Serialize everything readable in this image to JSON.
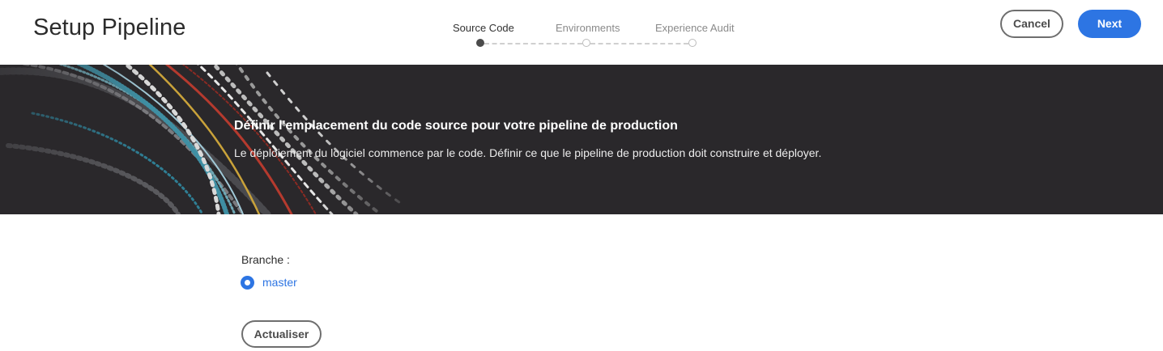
{
  "header": {
    "title": "Setup Pipeline",
    "cancel_label": "Cancel",
    "next_label": "Next"
  },
  "stepper": {
    "steps": [
      {
        "label": "Source Code",
        "state": "active"
      },
      {
        "label": "Environments",
        "state": "inactive"
      },
      {
        "label": "Experience Audit",
        "state": "inactive"
      }
    ]
  },
  "banner": {
    "title": "Définir l'emplacement du code source pour votre pipeline de production",
    "description": "Le déploiement du logiciel commence par le code. Définir ce que le pipeline de production doit construire et déployer."
  },
  "branch": {
    "label": "Branche :",
    "options": [
      {
        "label": "master",
        "selected": true
      }
    ]
  },
  "refresh_label": "Actualiser",
  "colors": {
    "accent": "#2d75e3",
    "banner_bg": "#2a282b",
    "text": "#2c2c2c"
  }
}
